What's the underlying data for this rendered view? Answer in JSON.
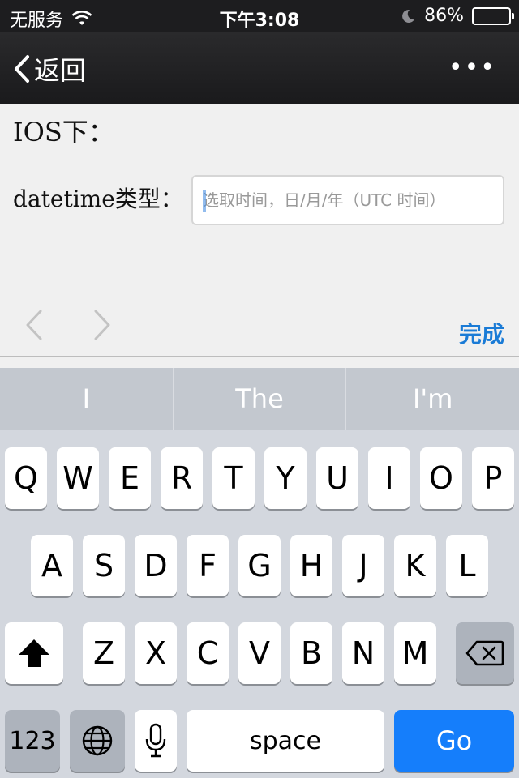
{
  "status_bar": {
    "carrier": "无服务",
    "time": "下午3:08",
    "battery_percent": "86%",
    "battery_level": 0.86
  },
  "nav": {
    "back_label": "返回",
    "more_label": "•••"
  },
  "content": {
    "heading": "IOS下：",
    "field_label": "datetime类型：",
    "input_placeholder": "选取时间，日/月/年（UTC 时间）",
    "input_value": ""
  },
  "accessory": {
    "prev_label": "‹",
    "next_label": "›",
    "done_label": "完成"
  },
  "predictive": [
    "I",
    "The",
    "I'm"
  ],
  "keyboard": {
    "row1": [
      "Q",
      "W",
      "E",
      "R",
      "T",
      "Y",
      "U",
      "I",
      "O",
      "P"
    ],
    "row2": [
      "A",
      "S",
      "D",
      "F",
      "G",
      "H",
      "J",
      "K",
      "L"
    ],
    "row3": [
      "Z",
      "X",
      "C",
      "V",
      "B",
      "N",
      "M"
    ],
    "numbers_label": "123",
    "space_label": "space",
    "go_label": "Go"
  },
  "colors": {
    "accent": "#1a7bd6",
    "go_key": "#157efb",
    "nav_bg": "#1d1d1f"
  }
}
